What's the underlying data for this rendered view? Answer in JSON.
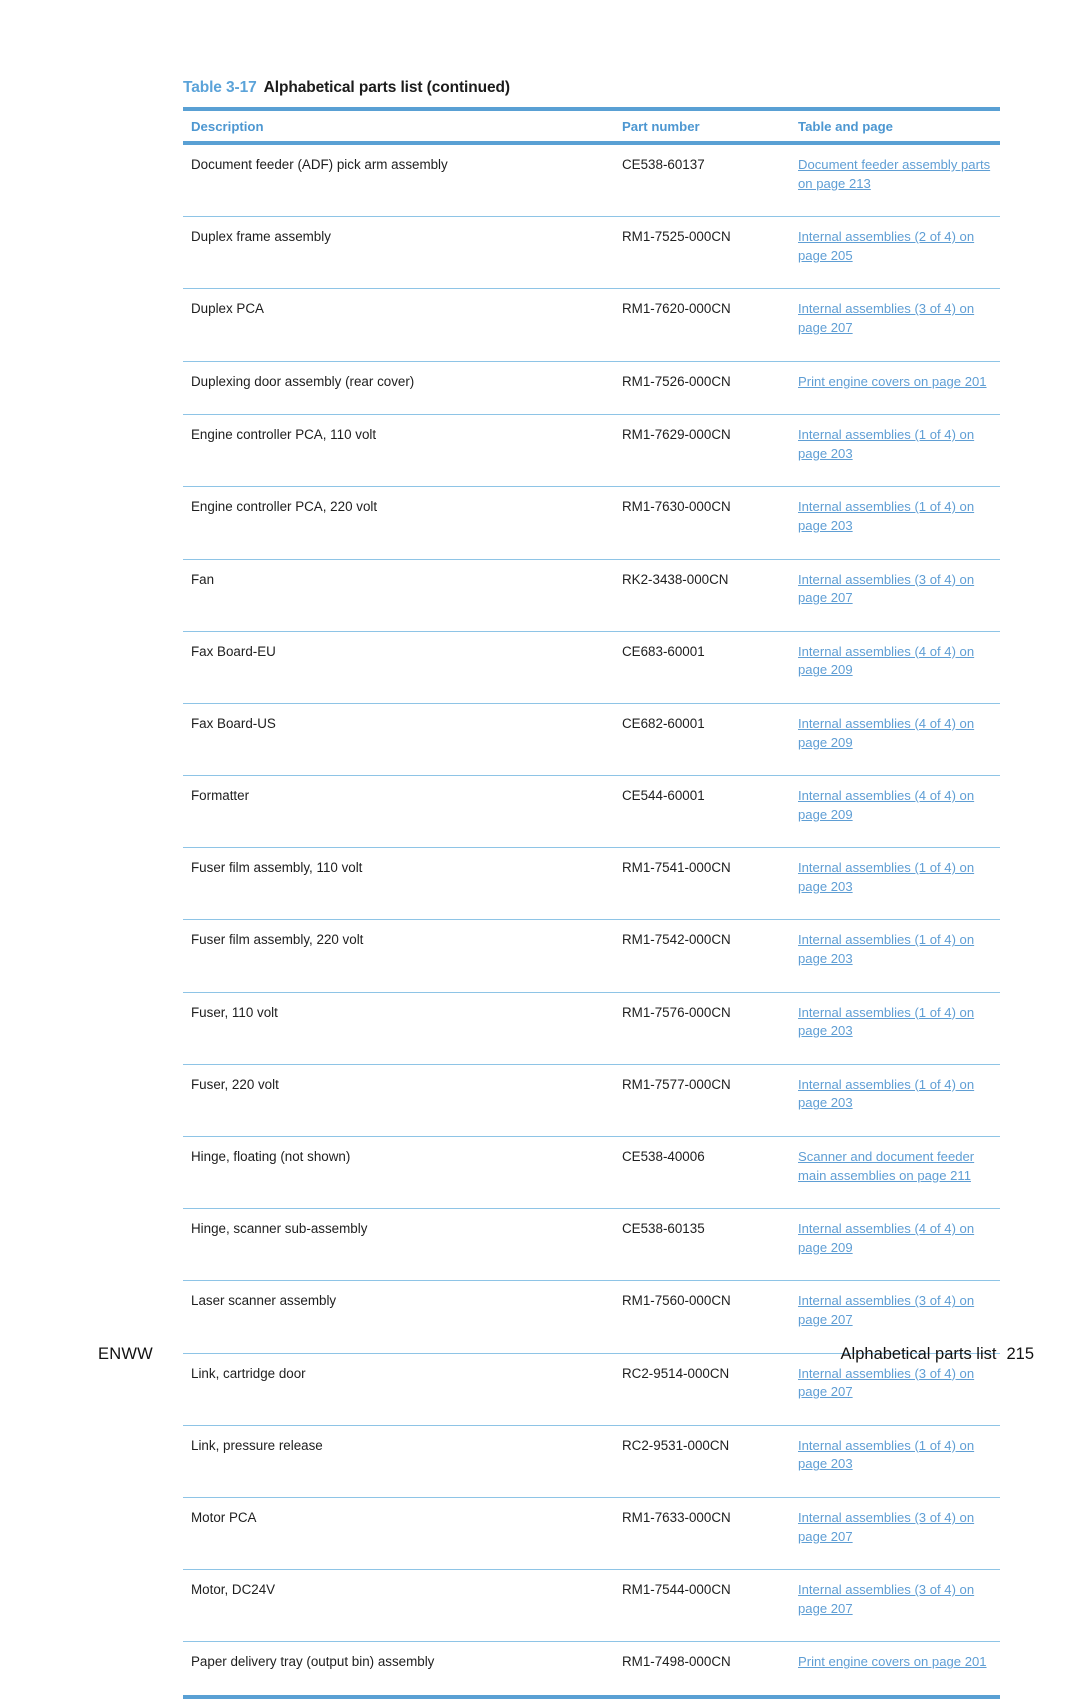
{
  "table": {
    "caption_number": "Table 3-17",
    "caption_title": "Alphabetical parts list (continued)",
    "columns": [
      "Description",
      "Part number",
      "Table and page"
    ],
    "accent_color": "#59a0d4",
    "link_color": "#5f9ed4",
    "rows": [
      {
        "description": "Document feeder (ADF) pick arm assembly",
        "part_number": "CE538-60137",
        "link": "Document feeder assembly parts on page 213"
      },
      {
        "description": "Duplex frame assembly",
        "part_number": "RM1-7525-000CN",
        "link": "Internal assemblies (2 of 4) on page 205"
      },
      {
        "description": "Duplex PCA",
        "part_number": "RM1-7620-000CN",
        "link": "Internal assemblies (3 of 4) on page 207"
      },
      {
        "description": "Duplexing door assembly (rear cover)",
        "part_number": "RM1-7526-000CN",
        "link": "Print engine covers on page 201"
      },
      {
        "description": "Engine controller PCA, 110 volt",
        "part_number": "RM1-7629-000CN",
        "link": "Internal assemblies (1 of 4) on page 203"
      },
      {
        "description": "Engine controller PCA, 220 volt",
        "part_number": "RM1-7630-000CN",
        "link": "Internal assemblies (1 of 4) on page 203"
      },
      {
        "description": "Fan",
        "part_number": "RK2-3438-000CN",
        "link": "Internal assemblies (3 of 4) on page 207"
      },
      {
        "description": "Fax Board-EU",
        "part_number": "CE683-60001",
        "link": "Internal assemblies (4 of 4) on page 209"
      },
      {
        "description": "Fax Board-US",
        "part_number": "CE682-60001",
        "link": "Internal assemblies (4 of 4) on page 209"
      },
      {
        "description": "Formatter",
        "part_number": "CE544-60001",
        "link": "Internal assemblies (4 of 4) on page 209"
      },
      {
        "description": "Fuser film assembly, 110 volt",
        "part_number": "RM1-7541-000CN",
        "link": "Internal assemblies (1 of 4) on page 203"
      },
      {
        "description": "Fuser film assembly, 220 volt",
        "part_number": "RM1-7542-000CN",
        "link": "Internal assemblies (1 of 4) on page 203"
      },
      {
        "description": "Fuser, 110 volt",
        "part_number": "RM1-7576-000CN",
        "link": "Internal assemblies (1 of 4) on page 203"
      },
      {
        "description": "Fuser, 220 volt",
        "part_number": "RM1-7577-000CN",
        "link": "Internal assemblies (1 of 4) on page 203"
      },
      {
        "description": "Hinge, floating (not shown)",
        "part_number": "CE538-40006",
        "link": "Scanner and document feeder main assemblies on page 211"
      },
      {
        "description": "Hinge, scanner sub-assembly",
        "part_number": "CE538-60135",
        "link": "Internal assemblies (4 of 4) on page 209"
      },
      {
        "description": "Laser scanner assembly",
        "part_number": "RM1-7560-000CN",
        "link": "Internal assemblies (3 of 4) on page 207"
      },
      {
        "description": "Link, cartridge door",
        "part_number": "RC2-9514-000CN",
        "link": "Internal assemblies (3 of 4) on page 207"
      },
      {
        "description": "Link, pressure release",
        "part_number": "RC2-9531-000CN",
        "link": "Internal assemblies (1 of 4) on page 203"
      },
      {
        "description": "Motor PCA",
        "part_number": "RM1-7633-000CN",
        "link": "Internal assemblies (3 of 4) on page 207"
      },
      {
        "description": "Motor, DC24V",
        "part_number": "RM1-7544-000CN",
        "link": "Internal assemblies (3 of 4) on page 207"
      },
      {
        "description": "Paper delivery tray (output bin) assembly",
        "part_number": "RM1-7498-000CN",
        "link": "Print engine covers on page 201"
      }
    ]
  },
  "footer": {
    "left": "ENWW",
    "section": "Alphabetical parts list",
    "page_number": "215"
  }
}
